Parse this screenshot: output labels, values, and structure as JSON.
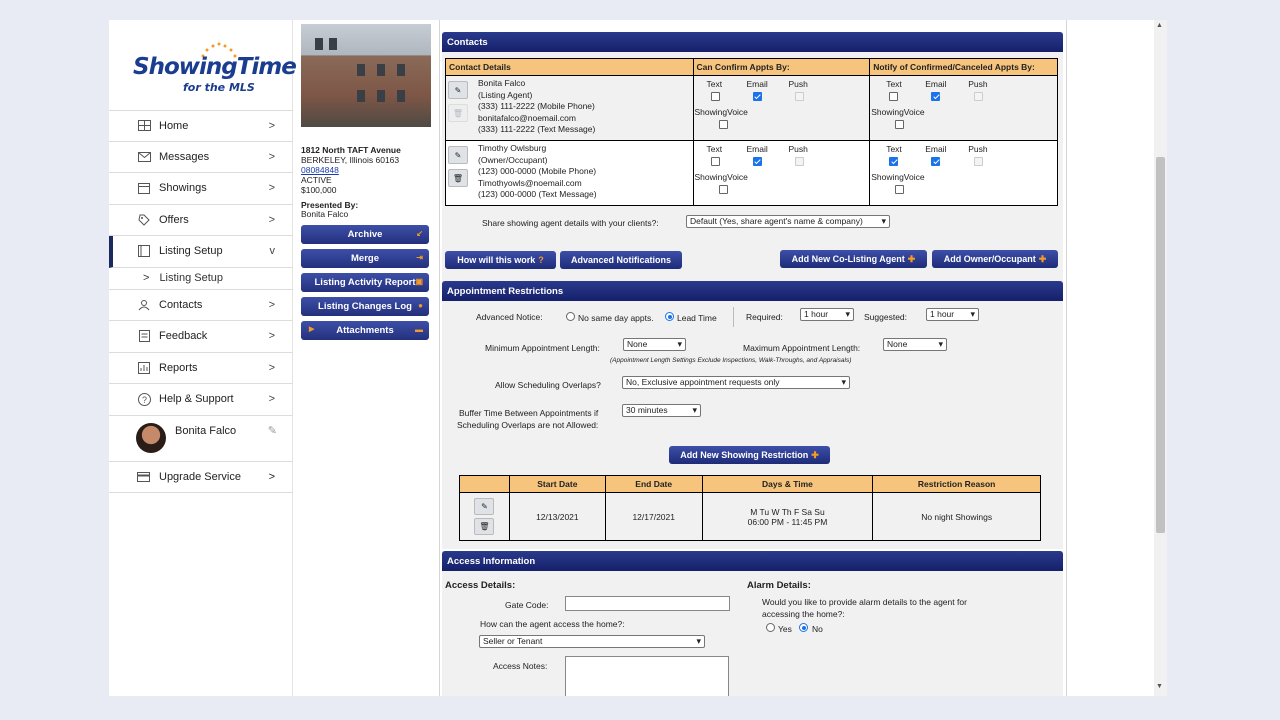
{
  "brand": {
    "name": "ShowingTime",
    "tagline": "for the MLS"
  },
  "nav": {
    "items": [
      {
        "label": "Home",
        "icon": "home-icon"
      },
      {
        "label": "Messages",
        "icon": "mail-icon"
      },
      {
        "label": "Showings",
        "icon": "calendar-icon"
      },
      {
        "label": "Offers",
        "icon": "offer-icon"
      },
      {
        "label": "Listing Setup",
        "icon": "listing-icon",
        "chevron": "v"
      },
      {
        "label": "Contacts",
        "icon": "contacts-icon"
      },
      {
        "label": "Feedback",
        "icon": "feedback-icon"
      },
      {
        "label": "Reports",
        "icon": "reports-icon"
      },
      {
        "label": "Help & Support",
        "icon": "help-icon"
      }
    ],
    "sub_item": "Listing Setup",
    "chevron": ">",
    "user_name": "Bonita Falco",
    "upgrade": "Upgrade Service"
  },
  "listing": {
    "address": "1812 North TAFT Avenue",
    "city": "BERKELEY, Illinois 60163",
    "mls": "08084848",
    "status": "ACTIVE",
    "price": "$100,000",
    "presented_by_label": "Presented By:",
    "presented_by": "Bonita Falco",
    "buttons": [
      "Archive",
      "Merge",
      "Listing Activity Report",
      "Listing Changes Log",
      "Attachments"
    ]
  },
  "contacts": {
    "header": "Contacts",
    "columns": [
      "Contact Details",
      "Can Confirm Appts By:",
      "Notify of Confirmed/Canceled Appts By:"
    ],
    "channel_labels": [
      "Text",
      "Email",
      "Push"
    ],
    "showingvoice_label": "ShowingVoice",
    "rows": [
      {
        "lines": [
          "Bonita Falco",
          "(Listing Agent)",
          "(333) 111-2222 (Mobile Phone)",
          "bonitafalco@noemail.com",
          "(333) 111-2222 (Text Message)"
        ],
        "confirm": {
          "text": false,
          "email": true,
          "push": false,
          "voice": false
        },
        "notify": {
          "text": false,
          "email": true,
          "push": false,
          "voice": false
        }
      },
      {
        "lines": [
          "Timothy Owlsburg",
          "(Owner/Occupant)",
          "(123) 000-0000 (Mobile Phone)",
          "Timothyowls@noemail.com",
          "(123) 000-0000 (Text Message)"
        ],
        "confirm": {
          "text": false,
          "email": true,
          "push": false,
          "voice": false
        },
        "notify": {
          "text": true,
          "email": true,
          "push": false,
          "voice": false
        }
      }
    ],
    "share_label": "Share showing agent details with your clients?:",
    "share_value": "Default (Yes, share agent's name & company)",
    "buttons": {
      "how": "How will this work",
      "advanced": "Advanced Notifications",
      "add_colist": "Add New Co-Listing Agent",
      "add_owner": "Add Owner/Occupant"
    }
  },
  "restrictions": {
    "header": "Appointment Restrictions",
    "advanced_notice_label": "Advanced Notice:",
    "no_same_day": "No same day appts.",
    "lead_time": "Lead Time",
    "required_label": "Required:",
    "required_value": "1 hour",
    "suggested_label": "Suggested:",
    "suggested_value": "1 hour",
    "min_len_label": "Minimum Appointment Length:",
    "min_len_value": "None",
    "max_len_label": "Maximum Appointment Length:",
    "max_len_value": "None",
    "length_note": "(Appointment Length Settings Exclude Inspections, Walk-Throughs, and Appraisals)",
    "overlap_label": "Allow Scheduling Overlaps?",
    "overlap_value": "No, Exclusive appointment requests only",
    "buffer_label_1": "Buffer Time Between Appointments if",
    "buffer_label_2": "Scheduling Overlaps are not Allowed:",
    "buffer_value": "30 minutes",
    "add_button": "Add New Showing Restriction",
    "table_headers": [
      "Start Date",
      "End Date",
      "Days & Time",
      "Restriction Reason"
    ],
    "rows": [
      {
        "start": "12/13/2021",
        "end": "12/17/2021",
        "days": "M Tu W Th F Sa Su",
        "time": "06:00 PM - 11:45 PM",
        "reason": "No night Showings"
      }
    ]
  },
  "access": {
    "header": "Access Information",
    "details_label": "Access Details:",
    "gate_label": "Gate Code:",
    "how_label": "How can the agent access the home?:",
    "how_value": "Seller or Tenant",
    "notes_label": "Access Notes:",
    "alarm_label": "Alarm Details:",
    "alarm_q1": "Would you like to provide alarm details to the agent for",
    "alarm_q2": "accessing the home?:",
    "yes": "Yes",
    "no": "No"
  }
}
